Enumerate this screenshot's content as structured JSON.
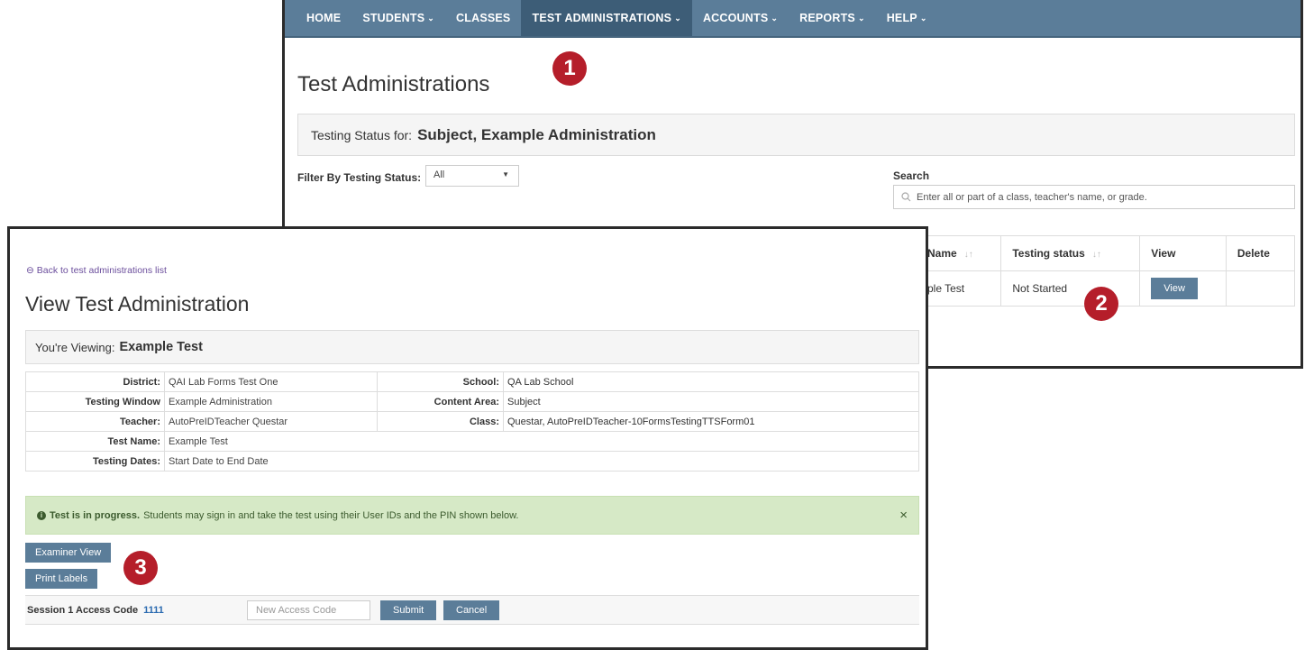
{
  "nav": {
    "items": [
      {
        "label": "HOME",
        "caret": false
      },
      {
        "label": "STUDENTS",
        "caret": true
      },
      {
        "label": "CLASSES",
        "caret": false
      },
      {
        "label": "TEST ADMINISTRATIONS",
        "caret": true,
        "active": true
      },
      {
        "label": "ACCOUNTS",
        "caret": true
      },
      {
        "label": "REPORTS",
        "caret": true
      },
      {
        "label": "HELP",
        "caret": true
      }
    ]
  },
  "back_page": {
    "title": "Test Administrations",
    "status_prefix": "Testing Status for:",
    "status_value": "Subject, Example Administration",
    "filter_label": "Filter By Testing Status:",
    "filter_value": "All",
    "search_label": "Search",
    "search_placeholder": "Enter all or part of a class, teacher's name, or grade.",
    "table": {
      "headers": [
        "Name",
        "Testing status",
        "View",
        "Delete"
      ],
      "row": {
        "name": "ple Test",
        "status": "Not Started",
        "view_label": "View"
      }
    }
  },
  "front_page": {
    "back_link": "Back to test administrations list",
    "title": "View Test Administration",
    "viewing_prefix": "You're Viewing:",
    "viewing_value": "Example Test",
    "info": {
      "district_label": "District:",
      "district": "QAI Lab Forms Test One",
      "school_label": "School:",
      "school": "QA Lab School",
      "window_label": "Testing Window",
      "window": "Example Administration",
      "content_label": "Content Area:",
      "content": "Subject",
      "teacher_label": "Teacher:",
      "teacher": "AutoPreIDTeacher Questar",
      "class_label": "Class:",
      "class": "Questar, AutoPreIDTeacher-10FormsTestingTTSForm01",
      "testname_label": "Test Name:",
      "testname": "Example Test",
      "dates_label": "Testing Dates:",
      "dates": "Start Date to End Date"
    },
    "alert_bold": "Test is in progress.",
    "alert_text": "Students may sign in and take the test using their User IDs and the PIN shown below.",
    "alert_close": "×",
    "examiner_button": "Examiner View",
    "print_button": "Print Labels",
    "session_label": "Session 1 Access Code",
    "session_code": "1111",
    "access_placeholder": "New Access Code",
    "submit_label": "Submit",
    "cancel_label": "Cancel"
  },
  "markers": [
    "1",
    "2",
    "3"
  ],
  "colors": {
    "nav": "#5b7d99",
    "marker": "#b51e2a",
    "alert_bg": "#d6e9c6"
  }
}
